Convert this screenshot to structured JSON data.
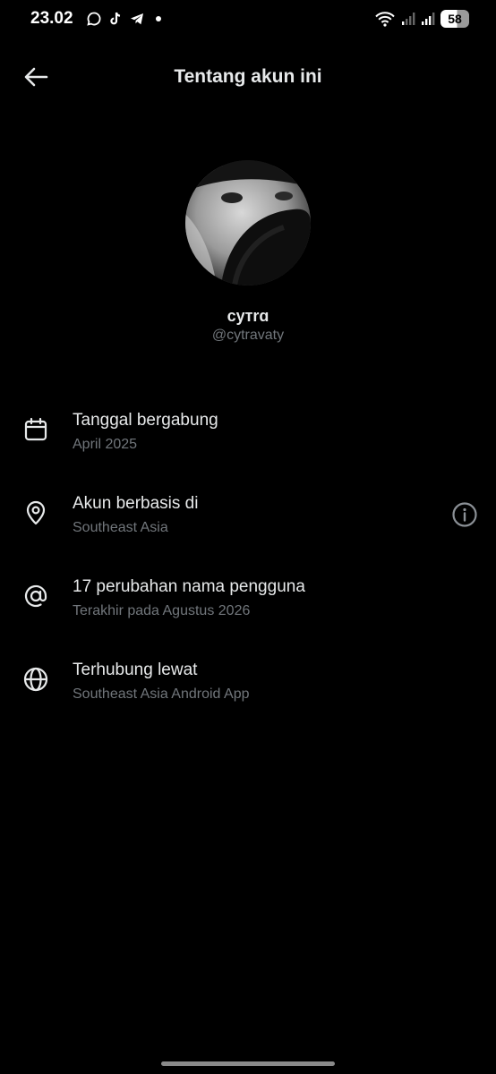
{
  "status_bar": {
    "time": "23.02",
    "battery": "58",
    "icons": [
      "chat-bubble-icon",
      "tiktok-icon",
      "telegram-icon",
      "notification-dot-icon",
      "wifi-icon",
      "signal-icon",
      "signal-icon",
      "battery-icon"
    ]
  },
  "header": {
    "back_icon": "arrow-left-icon",
    "title": "Tentang akun ini"
  },
  "profile": {
    "display_name": "cyтrɑ",
    "handle": "@cytravaty"
  },
  "info_items": [
    {
      "icon": "calendar-icon",
      "title": "Tanggal bergabung",
      "subtitle": "April 2025"
    },
    {
      "icon": "location-pin-icon",
      "title": "Akun berbasis di",
      "subtitle": "Southeast Asia",
      "action_icon": "info-icon"
    },
    {
      "icon": "at-sign-icon",
      "title": "17 perubahan nama pengguna",
      "subtitle": "Terakhir pada Agustus 2026"
    },
    {
      "icon": "globe-icon",
      "title": "Terhubung lewat",
      "subtitle": "Southeast Asia Android App"
    }
  ],
  "colors": {
    "background": "#000000",
    "primary_text": "#e7e9ea",
    "secondary_text": "#71767b"
  }
}
